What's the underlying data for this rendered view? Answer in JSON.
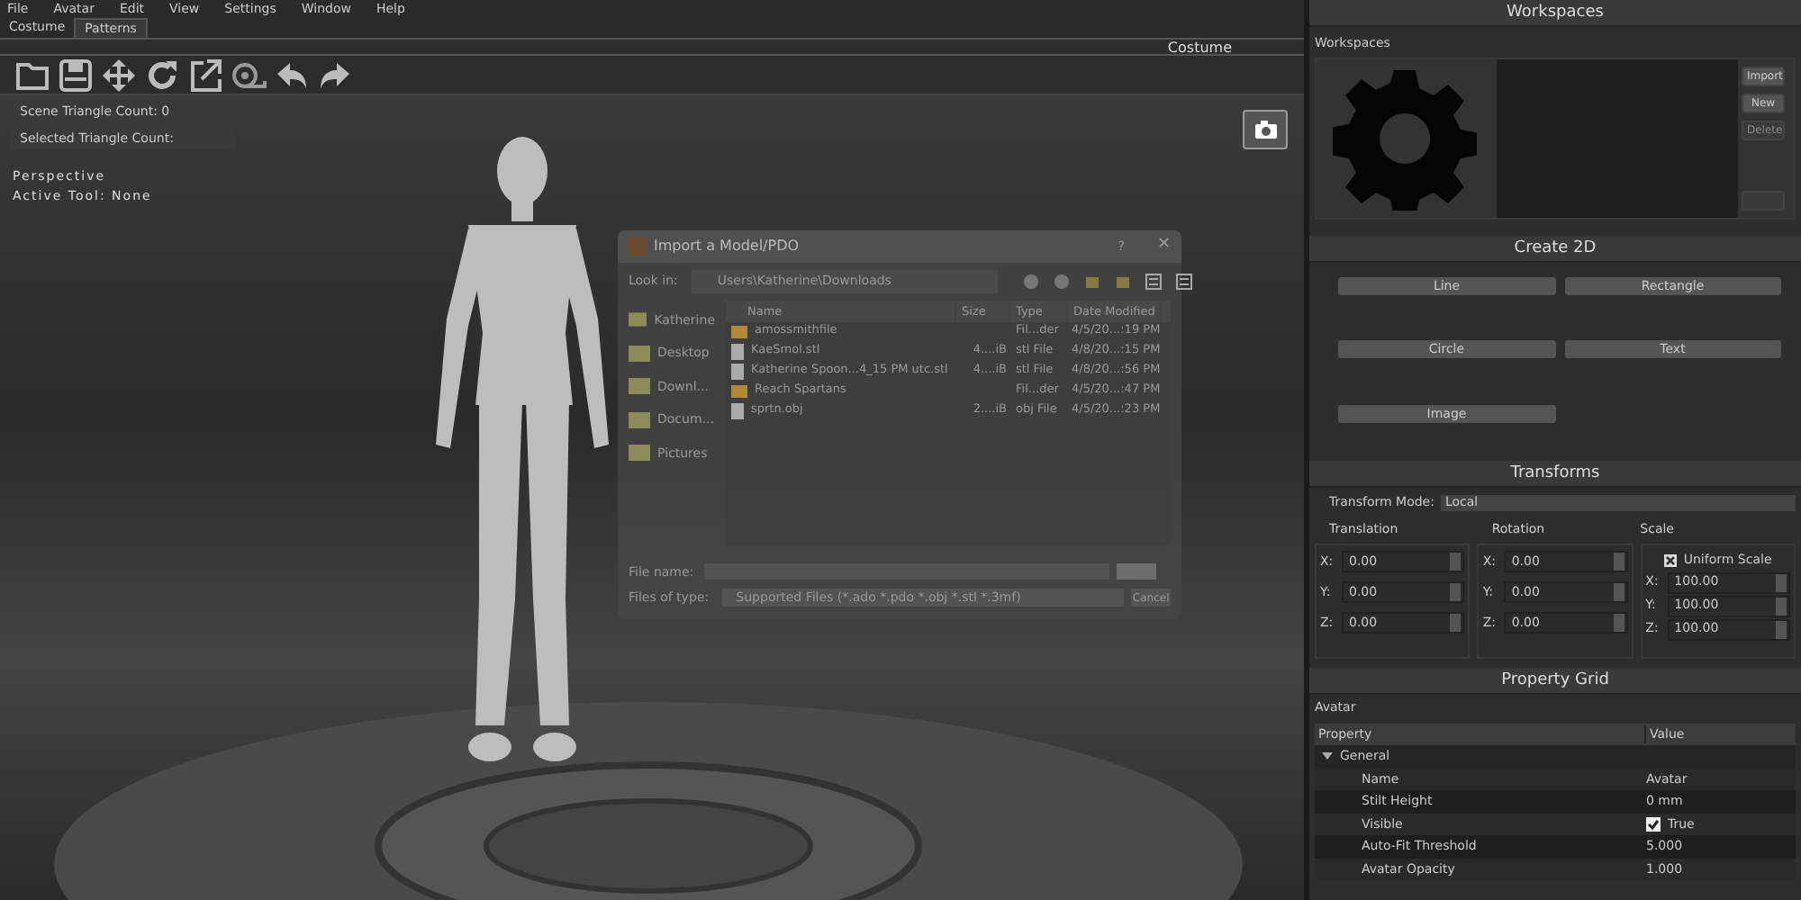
{
  "menu": [
    "File",
    "Avatar",
    "Edit",
    "View",
    "Settings",
    "Window",
    "Help"
  ],
  "tabs": [
    {
      "label": "Costume",
      "selected": false
    },
    {
      "label": "Patterns",
      "selected": true
    }
  ],
  "panel_title": "Costume",
  "viewport": {
    "counts": [
      "Scene Triangle Count: 0",
      "Selected Triangle Count:"
    ],
    "view_label": "Perspective",
    "active_tool": "Active Tool: None"
  },
  "dialog": {
    "title": "Import a Model/PDO",
    "help": "?",
    "close": "✕",
    "look_in_label": "Look in:",
    "path": "Users\\Katherine\\Downloads",
    "places": [
      "Katherine",
      "Desktop",
      "Downl...",
      "Docum...",
      "Pictures"
    ],
    "columns": [
      "Name",
      "Size",
      "Type",
      "Date Modified"
    ],
    "files": [
      {
        "kind": "folder",
        "name": "amossmithfile",
        "type": "Fil...der",
        "date": "4/5/20...:19 PM"
      },
      {
        "kind": "file",
        "name": "KaeSmol.stl",
        "size": "4....iB",
        "type": "stl File",
        "date": "4/8/20...:15 PM"
      },
      {
        "kind": "file",
        "name": "Katherine Spoon...4_15 PM utc.stl",
        "size": "4....iB",
        "type": "stl File",
        "date": "4/8/20...:56 PM"
      },
      {
        "kind": "folder",
        "name": "Reach Spartans",
        "type": "Fil...der",
        "date": "4/5/20...:47 PM"
      },
      {
        "kind": "file",
        "name": "sprtn.obj",
        "size": "2....iB",
        "type": "obj File",
        "date": "4/5/20...:23 PM"
      }
    ],
    "file_name_label": "File name:",
    "file_type_label": "Files of type:",
    "file_type": "Supported Files (*.ado *.pdo *.obj *.stl *.3mf)",
    "cancel": "Cancel"
  },
  "workspaces": {
    "title": "Workspaces",
    "label": "Workspaces",
    "buttons": [
      {
        "label": "Import",
        "disabled": false
      },
      {
        "label": "New",
        "disabled": false
      },
      {
        "label": "Delete",
        "disabled": true
      }
    ]
  },
  "create2d": {
    "title": "Create 2D",
    "buttons": [
      "Line",
      "Rectangle",
      "Circle",
      "Text",
      "Image"
    ]
  },
  "transforms": {
    "title": "Transforms",
    "mode_label": "Transform Mode:",
    "mode": "Local",
    "groups": [
      {
        "title": "Translation",
        "fields": [
          {
            "axis": "X:",
            "value": "0.00"
          },
          {
            "axis": "Y:",
            "value": "0.00"
          },
          {
            "axis": "Z:",
            "value": "0.00"
          }
        ]
      },
      {
        "title": "Rotation",
        "fields": [
          {
            "axis": "X:",
            "value": "0.00"
          },
          {
            "axis": "Y:",
            "value": "0.00"
          },
          {
            "axis": "Z:",
            "value": "0.00"
          }
        ]
      },
      {
        "title": "Scale",
        "fields": [
          {
            "axis": "X:",
            "value": "100.00"
          },
          {
            "axis": "Y:",
            "value": "100.00"
          },
          {
            "axis": "Z:",
            "value": "100.00"
          }
        ]
      }
    ],
    "uniform_scale": {
      "label": "Uniform Scale",
      "checked": true
    }
  },
  "property_grid": {
    "title": "Property Grid",
    "object": "Avatar",
    "columns": [
      "Property",
      "Value"
    ],
    "category": {
      "label": "General",
      "expanded": true
    },
    "rows": [
      {
        "kind": "text",
        "name": "Name",
        "value": "Avatar"
      },
      {
        "kind": "text",
        "name": "Stilt Height",
        "value": "0 mm"
      },
      {
        "kind": "checkbox",
        "name": "Visible",
        "value": "True",
        "checked": true
      },
      {
        "kind": "text",
        "name": "Auto-Fit Threshold",
        "value": "5.000"
      },
      {
        "kind": "text",
        "name": "Avatar Opacity",
        "value": "1.000"
      }
    ]
  }
}
